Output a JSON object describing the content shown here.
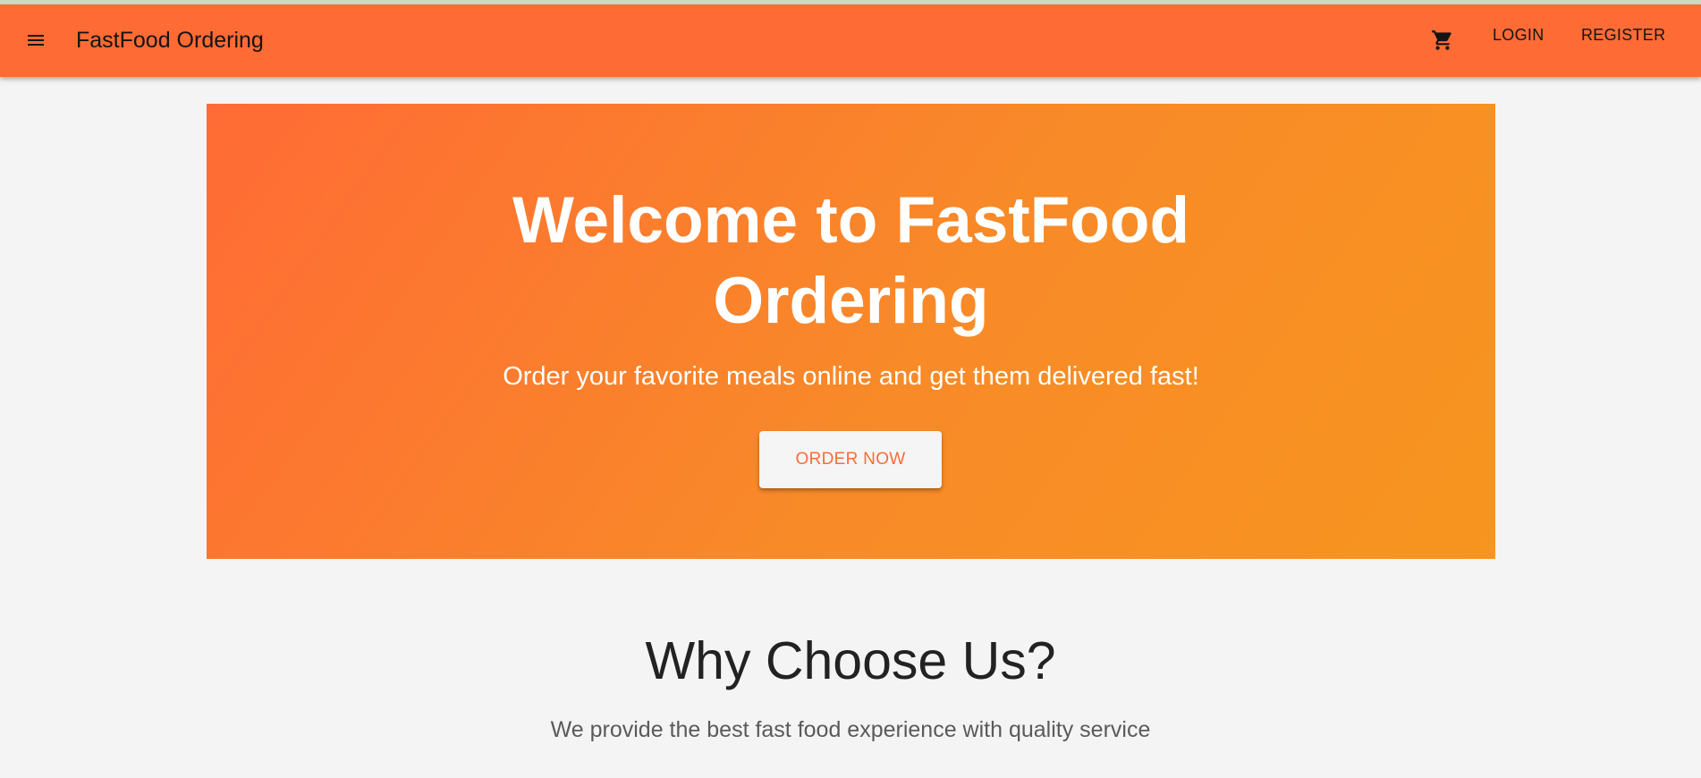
{
  "app_bar": {
    "menu_icon": "menu-icon",
    "title": "FastFood Ordering",
    "cart_icon": "shopping-cart-icon",
    "login_label": "LOGIN",
    "register_label": "REGISTER",
    "background_color": "#ff6b35"
  },
  "hero": {
    "title_line1": "Welcome to FastFood",
    "title_line2": "Ordering",
    "subtitle": "Order your favorite meals online and get them delivered fast!",
    "cta_label": "ORDER NOW",
    "gradient_start": "#ff6b35",
    "gradient_end": "#f7951f"
  },
  "features": {
    "title": "Why Choose Us?",
    "subtitle": "We provide the best fast food experience with quality service"
  }
}
